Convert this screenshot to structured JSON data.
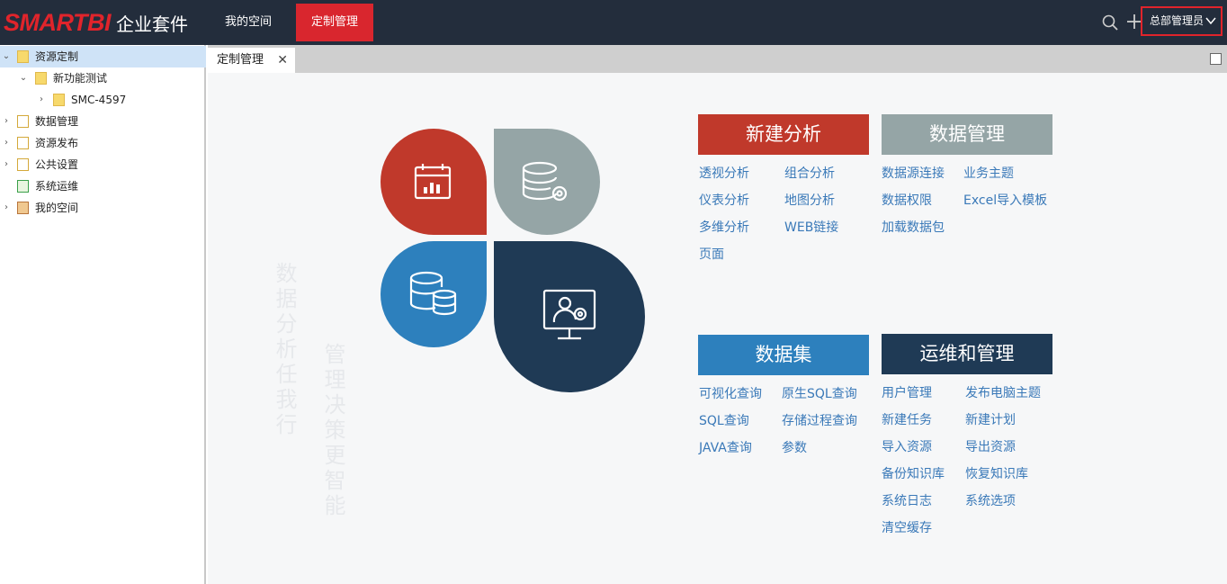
{
  "header": {
    "brand": "SMARTBI",
    "suite": "企业套件",
    "tabs": [
      "我的空间",
      "定制管理"
    ],
    "user": "总部管理员"
  },
  "sidebar": {
    "items": [
      {
        "label": "资源定制",
        "icon": "folder-icon"
      },
      {
        "label": "新功能测试",
        "icon": "folder-icon"
      },
      {
        "label": "SMC-4597",
        "icon": "folder-icon"
      },
      {
        "label": "数据管理",
        "icon": "data-management-icon"
      },
      {
        "label": "资源发布",
        "icon": "publish-icon"
      },
      {
        "label": "公共设置",
        "icon": "settings-icon"
      },
      {
        "label": "系统运维",
        "icon": "maintenance-icon"
      },
      {
        "label": "我的空间",
        "icon": "user-space-icon"
      }
    ]
  },
  "content_tab": {
    "label": "定制管理",
    "close": "✕"
  },
  "watermark": {
    "col1": "数据分析任我行",
    "col2": "管理决策更智能"
  },
  "colors": {
    "red": "#c0392b",
    "gray": "#95a5a6",
    "blue": "#2d80bd",
    "navy": "#1f3a55"
  },
  "sections": {
    "analysis": {
      "title": "新建分析",
      "links": [
        "透视分析",
        "组合分析",
        "仪表分析",
        "地图分析",
        "多维分析",
        "WEB链接",
        "页面"
      ]
    },
    "data_mgmt": {
      "title": "数据管理",
      "links": [
        "数据源连接",
        "业务主题",
        "数据权限",
        "Excel导入模板",
        "加载数据包"
      ]
    },
    "dataset": {
      "title": "数据集",
      "links": [
        "可视化查询",
        "原生SQL查询",
        "SQL查询",
        "存储过程查询",
        "JAVA查询",
        "参数"
      ]
    },
    "ops": {
      "title": "运维和管理",
      "links": [
        "用户管理",
        "发布电脑主题",
        "新建任务",
        "新建计划",
        "导入资源",
        "导出资源",
        "备份知识库",
        "恢复知识库",
        "系统日志",
        "系统选项",
        "清空缓存"
      ]
    }
  }
}
